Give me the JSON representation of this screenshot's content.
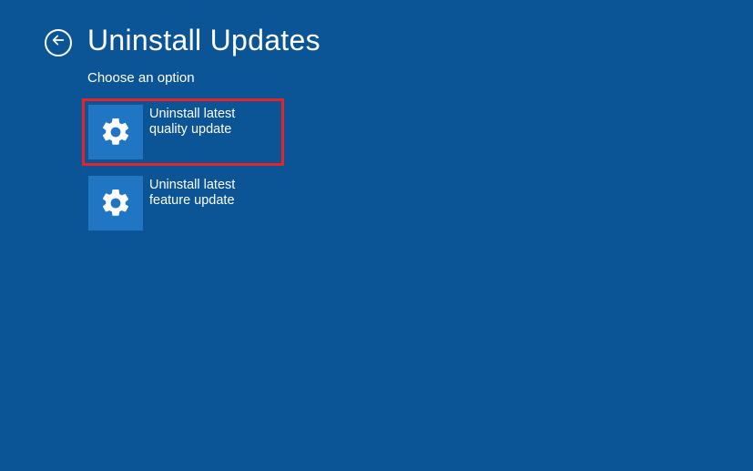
{
  "header": {
    "title": "Uninstall Updates",
    "subtitle": "Choose an option"
  },
  "options": [
    {
      "label": "Uninstall latest quality update",
      "icon": "gear-icon",
      "highlighted": true
    },
    {
      "label": "Uninstall latest feature update",
      "icon": "gear-icon",
      "highlighted": false
    }
  ],
  "colors": {
    "background": "#0b5496",
    "tile": "#2176c4",
    "highlight_border": "#e62328"
  }
}
